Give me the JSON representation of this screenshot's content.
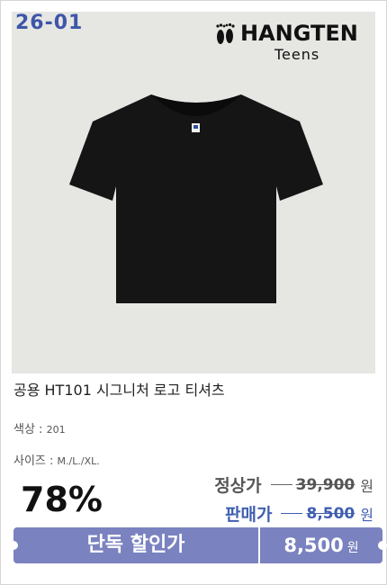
{
  "product": {
    "code": "26-01",
    "brand_name": "HANGTEN",
    "brand_sub": "Teens",
    "title": "공용 HT101 시그니처 로고 티셔츠",
    "color_label": "색상 :",
    "color_value": "201",
    "size_label": "사이즈 :",
    "size_value": "M./L./XL.",
    "discount": "78%",
    "regular_label": "정상가",
    "regular_price": "39,900",
    "sale_label": "판매가",
    "sale_price": "8,500",
    "currency": "원",
    "banner_label": "단독 할인가",
    "banner_price": "8,500",
    "banner_currency": "원"
  },
  "colors": {
    "accent": "#7a82bf",
    "code_blue": "#3e56a8",
    "sale_blue": "#3f5fb0"
  },
  "icons": {
    "logo": "footprints-logo-icon",
    "shirt": "black-tshirt-image"
  }
}
